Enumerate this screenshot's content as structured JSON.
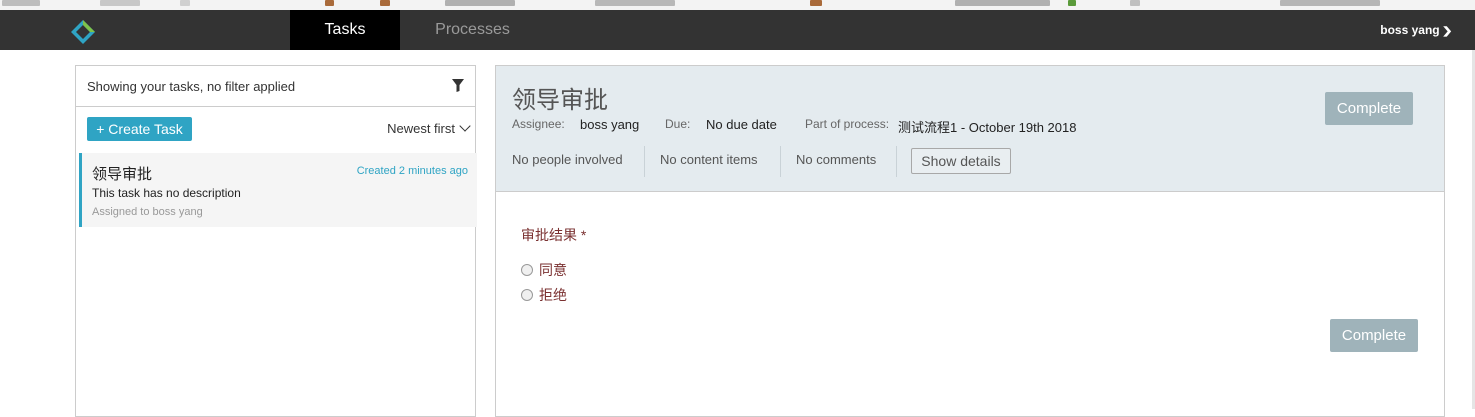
{
  "navbar": {
    "tabs": [
      {
        "label": "Tasks",
        "active": true
      },
      {
        "label": "Processes",
        "active": false
      }
    ],
    "user": {
      "name": "boss yang",
      "icon": "chevron-down-icon"
    }
  },
  "task_list": {
    "filter_text": "Showing your tasks, no filter applied",
    "create_button": "+ Create Task",
    "sort_label": "Newest first",
    "items": [
      {
        "title": "领导审批",
        "created": "Created 2 minutes ago",
        "description": "This task has no description",
        "assigned": "Assigned to boss yang"
      }
    ]
  },
  "task_detail": {
    "title": "领导审批",
    "assignee_label": "Assignee:",
    "assignee_value": "boss yang",
    "due_label": "Due:",
    "due_value": "No due date",
    "process_label": "Part of process:",
    "process_value": "测试流程1 - October 19th 2018",
    "complete_button": "Complete",
    "people": "No people involved",
    "content": "No content items",
    "comments": "No comments",
    "show_details": "Show details"
  },
  "form": {
    "field_label": "审批结果 *",
    "options": [
      "同意",
      "拒绝"
    ],
    "complete_button": "Complete"
  },
  "colors": {
    "navbar": "#333333",
    "accent": "#2fa4c4",
    "button_disabled": "#9fb3ba",
    "header_bg": "#e4ebef",
    "form_label": "#7a3030"
  }
}
